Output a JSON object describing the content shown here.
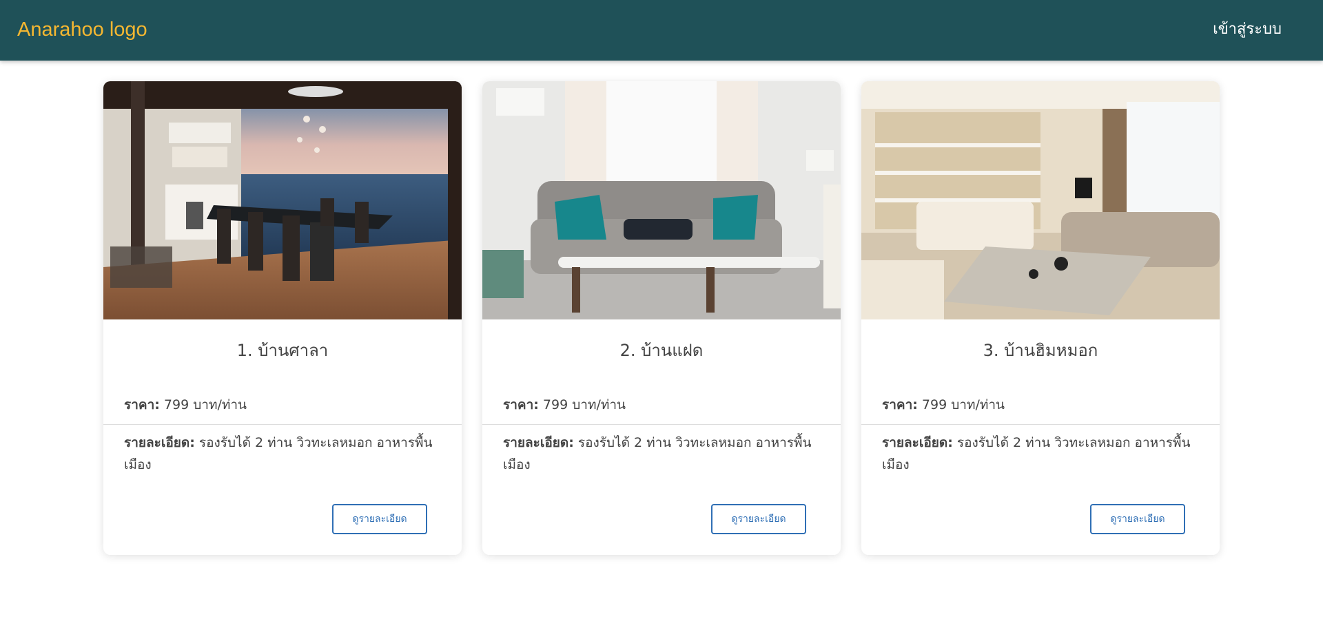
{
  "header": {
    "logo": "Anarahoo logo",
    "login_label": "เข้าสู่ระบบ",
    "background_color": "#1f5158",
    "logo_color": "#f5b731"
  },
  "cards": [
    {
      "image": "dining-room-sea-view-photo",
      "title": "1. บ้านศาลา",
      "price_label": "ราคา:",
      "price_value": "799 บาท/ท่าน",
      "detail_label": "รายละเอียด:",
      "detail_value": "รองรับได้ 2 ท่าน วิวทะเลหมอก อาหารพื้นเมือง",
      "button_label": "ดูรายละเอียด"
    },
    {
      "image": "living-room-gray-sofa-photo",
      "title": "2. บ้านแฝด",
      "price_label": "ราคา:",
      "price_value": "799 บาท/ท่าน",
      "detail_label": "รายละเอียด:",
      "detail_value": "รองรับได้ 2 ท่าน วิวทะเลหมอก อาหารพื้นเมือง",
      "button_label": "ดูรายละเอียด"
    },
    {
      "image": "luxury-living-room-photo",
      "title": "3. บ้านฮิมหมอก",
      "price_label": "ราคา:",
      "price_value": "799 บาท/ท่าน",
      "detail_label": "รายละเอียด:",
      "detail_value": "รองรับได้ 2 ท่าน วิวทะเลหมอก อาหารพื้นเมือง",
      "button_label": "ดูรายละเอียด"
    }
  ],
  "accent_button_color": "#2f6fb5"
}
